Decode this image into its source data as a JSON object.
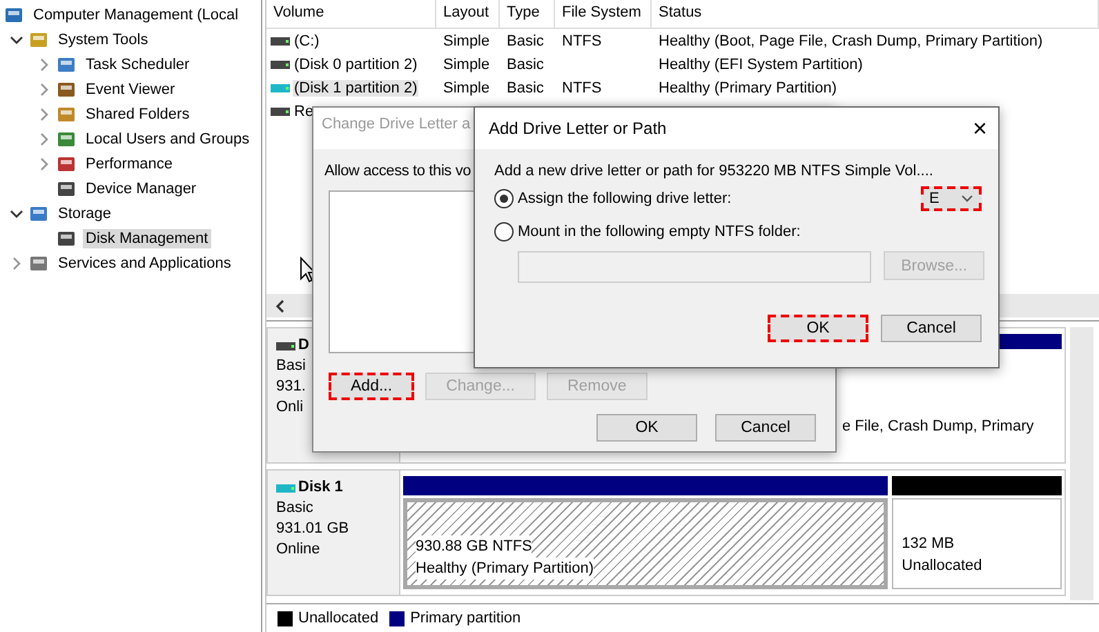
{
  "tree": [
    {
      "label": "Computer Management (Local",
      "children": [
        {
          "label": "System Tools",
          "expanded": true,
          "children": [
            {
              "label": "Task Scheduler",
              "expanded": false
            },
            {
              "label": "Event Viewer",
              "expanded": false
            },
            {
              "label": "Shared Folders",
              "expanded": false
            },
            {
              "label": "Local Users and Groups",
              "expanded": false
            },
            {
              "label": "Performance",
              "expanded": false
            },
            {
              "label": "Device Manager",
              "selected": false
            }
          ]
        },
        {
          "label": "Storage",
          "expanded": true,
          "children": [
            {
              "label": "Disk Management",
              "selected": true
            }
          ]
        },
        {
          "label": "Services and Applications",
          "expanded": false
        }
      ]
    }
  ],
  "volumes": {
    "columns": [
      "Volume",
      "Layout",
      "Type",
      "File System",
      "Status"
    ],
    "rows": [
      {
        "cells": [
          "(C:)",
          "Simple",
          "Basic",
          "NTFS",
          "Healthy (Boot, Page File, Crash Dump, Primary Partition)"
        ],
        "selected": false
      },
      {
        "cells": [
          "(Disk 0 partition 2)",
          "Simple",
          "Basic",
          "",
          "Healthy (EFI System Partition)"
        ],
        "selected": false
      },
      {
        "cells": [
          "(Disk 1 partition 2)",
          "Simple",
          "Basic",
          "NTFS",
          "Healthy (Primary Partition)"
        ],
        "selected": true
      },
      {
        "cells": [
          "Re"
        ],
        "selected": false
      }
    ]
  },
  "disks": [
    {
      "name": "D",
      "lines": [
        "Basi",
        "931.",
        "Onli"
      ],
      "partition_text": "e File, Crash Dump, Primary"
    },
    {
      "name": "Disk 1",
      "lines": [
        "Basic",
        "931.01 GB",
        "Online"
      ],
      "partitions": [
        {
          "kind": "primary",
          "lines": [
            "930.88 GB NTFS",
            "Healthy (Primary Partition)"
          ],
          "selected": true
        },
        {
          "kind": "unallocated",
          "lines": [
            "132 MB",
            "Unallocated"
          ],
          "selected": false
        }
      ]
    }
  ],
  "legend": [
    {
      "label": "Unallocated",
      "color": "#000000"
    },
    {
      "label": "Primary partition",
      "color": "#000080"
    }
  ],
  "change_dialog": {
    "title": "Change Drive Letter a",
    "prompt": "Allow access to this vo",
    "buttons": [
      {
        "label": "Add...",
        "disabled": false,
        "highlighted": true
      },
      {
        "label": "Change...",
        "disabled": true,
        "highlighted": false
      },
      {
        "label": "Remove",
        "disabled": true,
        "highlighted": false
      }
    ],
    "footer": [
      {
        "label": "OK"
      },
      {
        "label": "Cancel"
      }
    ]
  },
  "add_dialog": {
    "title": "Add Drive Letter or Path",
    "close": "×",
    "description": "Add a new drive letter or path for 953220 MB NTFS Simple Vol....",
    "options": [
      {
        "label": "Assign the following drive letter:",
        "selected": true
      },
      {
        "label": "Mount in the following empty NTFS folder:",
        "selected": false
      }
    ],
    "drive_letter": {
      "value": "E",
      "highlighted": true
    },
    "folder_field": {
      "disabled": true
    },
    "browse": {
      "label": "Browse...",
      "disabled": true
    },
    "footer": [
      {
        "label": "OK",
        "highlighted": true
      },
      {
        "label": "Cancel",
        "highlighted": false
      }
    ]
  }
}
